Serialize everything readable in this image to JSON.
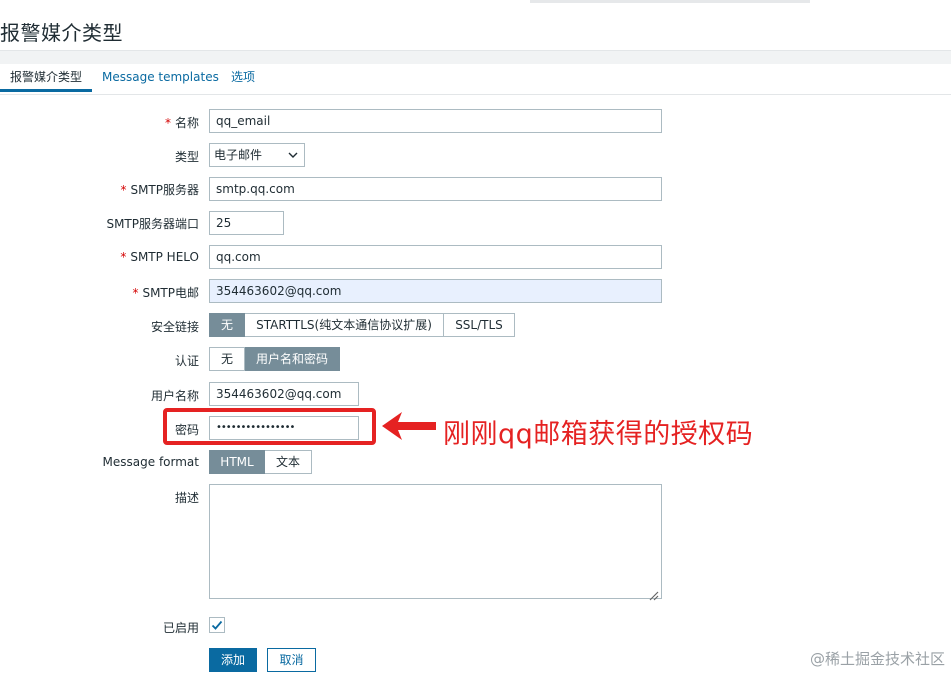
{
  "page": {
    "title": "报警媒介类型"
  },
  "tabs": [
    {
      "label": "报警媒介类型",
      "active": true
    },
    {
      "label": "Message templates",
      "active": false
    },
    {
      "label": "选项",
      "active": false
    }
  ],
  "form": {
    "name": {
      "label": "名称",
      "required": true,
      "value": "qq_email"
    },
    "type": {
      "label": "类型",
      "required": false,
      "value": "电子邮件"
    },
    "smtp_server": {
      "label": "SMTP服务器",
      "required": true,
      "value": "smtp.qq.com"
    },
    "smtp_port": {
      "label": "SMTP服务器端口",
      "required": false,
      "value": "25"
    },
    "smtp_helo": {
      "label": "SMTP HELO",
      "required": true,
      "value": "qq.com"
    },
    "smtp_email": {
      "label": "SMTP电邮",
      "required": true,
      "value": "354463602@qq.com"
    },
    "security": {
      "label": "安全链接",
      "options": [
        "无",
        "STARTTLS(纯文本通信协议扩展)",
        "SSL/TLS"
      ],
      "selected": "无"
    },
    "auth": {
      "label": "认证",
      "options": [
        "无",
        "用户名和密码"
      ],
      "selected": "用户名和密码"
    },
    "username": {
      "label": "用户名称",
      "value": "354463602@qq.com"
    },
    "password": {
      "label": "密码",
      "value": "••••••••••••••••"
    },
    "message_format": {
      "label": "Message format",
      "options": [
        "HTML",
        "文本"
      ],
      "selected": "HTML"
    },
    "description": {
      "label": "描述",
      "value": ""
    },
    "enabled": {
      "label": "已启用",
      "checked": true
    }
  },
  "buttons": {
    "add": "添加",
    "cancel": "取消"
  },
  "annotation": {
    "text": "刚刚qq邮箱获得的授权码",
    "color": "#e52222"
  },
  "watermark": "@稀土掘金技术社区",
  "colors": {
    "accent": "#0a6aa1",
    "selected_segment": "#768d99",
    "required": "#d40000",
    "autofill": "#e8f0fe"
  },
  "icons": {
    "dropdown": "chevron-down-icon",
    "checkbox": "checkmark-icon",
    "resize": "resize-grip-icon",
    "annotation": "arrow-left-icon"
  }
}
